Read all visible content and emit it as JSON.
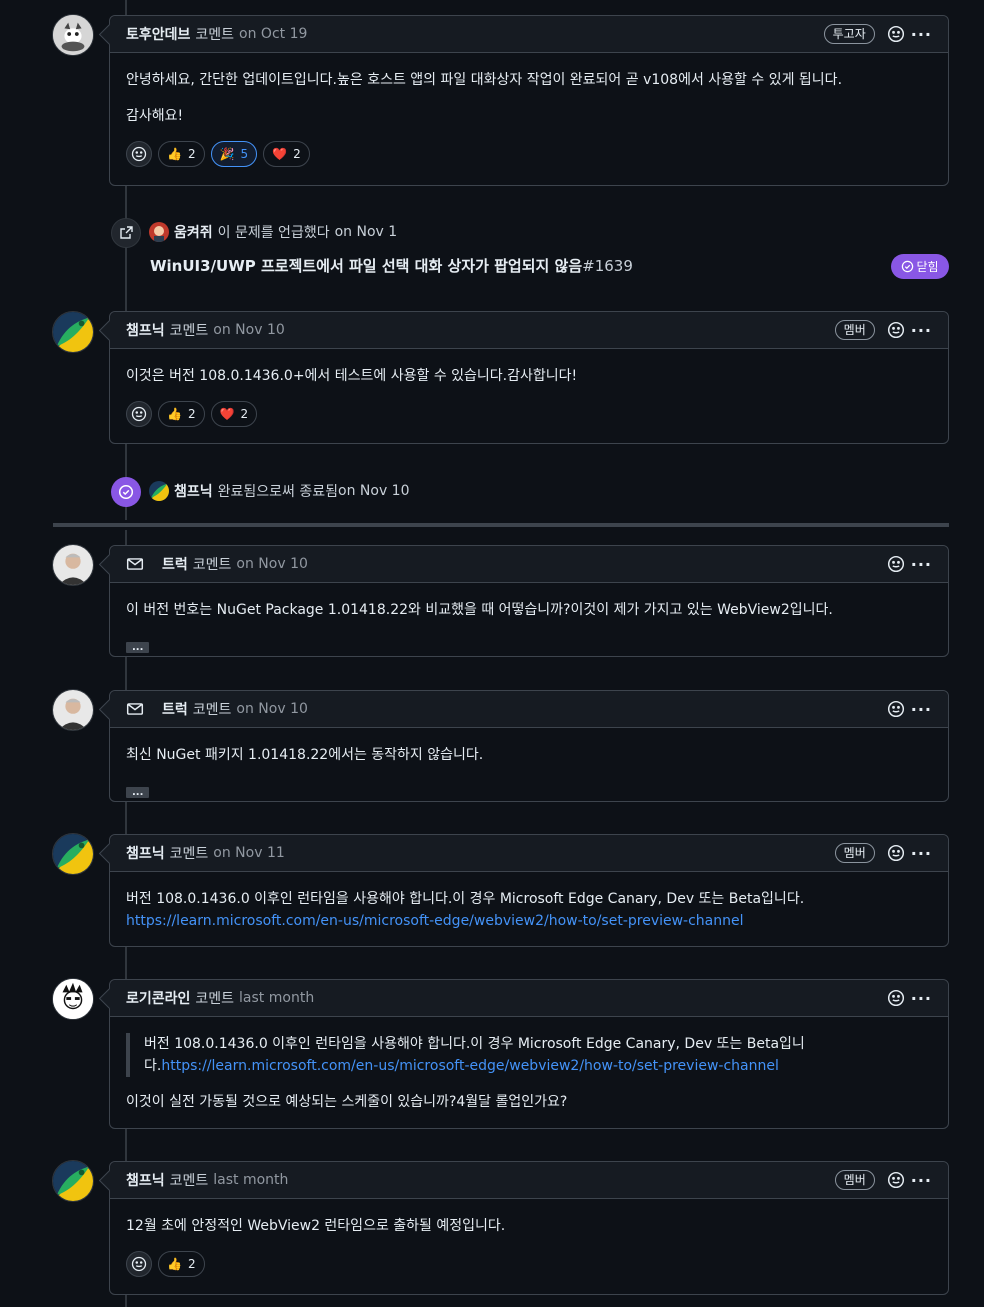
{
  "comments": [
    {
      "author": "토후안데브",
      "verb": "코멘트",
      "when": "on Oct 19",
      "badge": "투고자",
      "body": [
        "안녕하세요, 간단한 업데이트입니다.높은 호스트 앱의 파일 대화상자 작업이 완료되어 곧 v108에서 사용할 수 있게 됩니다.",
        "감사해요!"
      ],
      "reactions": [
        {
          "emoji": "👍",
          "count": "2"
        },
        {
          "emoji": "🎉",
          "count": "5"
        },
        {
          "emoji": "❤️",
          "count": "2"
        }
      ]
    },
    {
      "author": "챔프닉",
      "verb": "코멘트",
      "when": "on Nov 10",
      "badge": "멤버",
      "body": [
        "이것은 버전 108.0.1436.0+에서 테스트에 사용할 수 있습니다.감사합니다!"
      ],
      "reactions": [
        {
          "emoji": "👍",
          "count": "2"
        },
        {
          "emoji": "❤️",
          "count": "2"
        }
      ]
    },
    {
      "author": "트럭",
      "verb": "코멘트",
      "when": "on Nov 10",
      "body": [
        "이 버전 번호는 NuGet Package 1.01418.22와 비교했을 때 어떻습니까?이것이 제가 가지고 있는 WebView2입니다."
      ],
      "ellipsis": "..."
    },
    {
      "author": "트럭",
      "verb": "코멘트",
      "when": "on Nov 10",
      "body": [
        "최신 NuGet 패키지 1.01418.22에서는 동작하지 않습니다."
      ],
      "ellipsis": "..."
    },
    {
      "author": "챔프닉",
      "verb": "코멘트",
      "when": "on Nov 11",
      "badge": "멤버",
      "body": [
        "버전 108.0.1436.0 이후인 런타임을 사용해야 합니다.이 경우 Microsoft Edge Canary, Dev 또는 Beta입니다."
      ],
      "link": "https://learn.microsoft.com/en-us/microsoft-edge/webview2/how-to/set-preview-channel"
    },
    {
      "author": "로기콘라인",
      "verb": "코멘트",
      "when": "last month",
      "quote_line1": "버전 108.0.1436.0 이후인 런타임을 사용해야 합니다.이 경우 Microsoft Edge Canary, Dev 또는 Beta입니",
      "quote_line2_prefix": "다.",
      "quote_link": "https://learn.microsoft.com/en-us/microsoft-edge/webview2/how-to/set-preview-channel",
      "body": [
        "이것이 실전 가동될 것으로 예상되는 스케줄이 있습니까?4월달 롤업인가요?"
      ]
    },
    {
      "author": "챔프닉",
      "verb": "코멘트",
      "when": "last month",
      "badge": "멤버",
      "body": [
        "12월 초에 안정적인 WebView2 런타임으로 출하될 예정입니다."
      ],
      "reactions": [
        {
          "emoji": "👍",
          "count": "2"
        }
      ]
    }
  ],
  "events": {
    "mention": {
      "author": "움켜쥐",
      "text": "이 문제를 언급했다",
      "when": "on Nov 1",
      "issue_title": "WinUI3/UWP 프로젝트에서 파일 선택 대화 상자가 팝업되지 않음",
      "issue_number": "#1639",
      "status_label": "닫힘"
    },
    "closed": {
      "author": "챔프닉",
      "text": "완료됨으로써 종료됨",
      "when": "on Nov 10"
    }
  },
  "colors": {
    "background": "#0d1117",
    "header": "#161b22",
    "border": "#3d444d",
    "link": "#4493f8",
    "closed_purple": "#8957e5"
  },
  "icons": {
    "smiley": "smiley-icon",
    "kebab": "kebab-horizontal-icon",
    "mail": "mail-icon",
    "cross_reference": "cross-reference-icon",
    "check_circle": "check-circle-icon"
  }
}
